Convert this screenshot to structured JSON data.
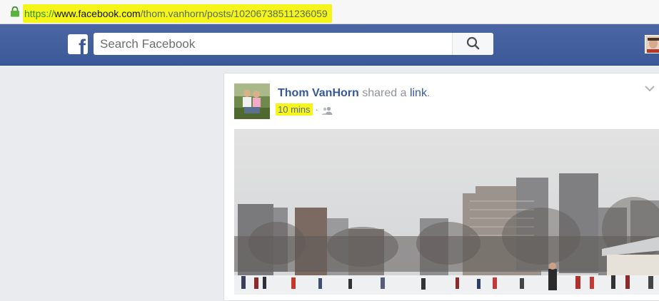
{
  "browser": {
    "url_scheme": "https://",
    "url_host": "www.facebook.com",
    "url_path": "/thom.vanhorn/posts/10206738511236059"
  },
  "header": {
    "logo": "f",
    "search_placeholder": "Search Facebook",
    "brand_color": "#3b5998"
  },
  "post": {
    "author": "Thom VanHorn",
    "action_text": " shared a ",
    "action_link": "link",
    "action_end": ".",
    "time": "10 mins",
    "separator": "·",
    "audience_icon": "friends-icon",
    "image_subject": "ice skating rink with city skyline"
  },
  "colors": {
    "highlight": "#f5f51a",
    "link": "#365899",
    "meta": "#90949c"
  }
}
